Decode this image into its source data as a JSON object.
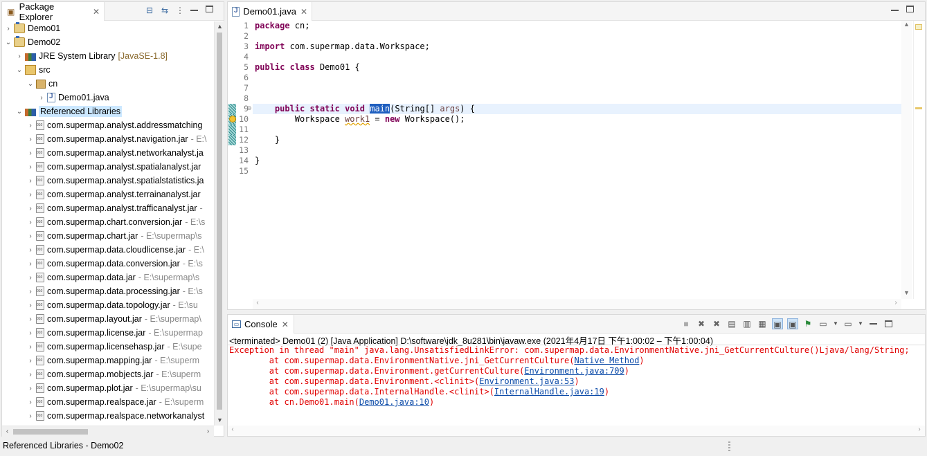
{
  "package_explorer": {
    "tab_label": "Package Explorer",
    "tree": [
      {
        "depth": 0,
        "chevron": "collapsed",
        "icon": "project",
        "label": "Demo01"
      },
      {
        "depth": 0,
        "chevron": "expanded",
        "icon": "project",
        "label": "Demo02"
      },
      {
        "depth": 1,
        "chevron": "collapsed",
        "icon": "library",
        "label": "JRE System Library",
        "tag": "[JavaSE-1.8]"
      },
      {
        "depth": 1,
        "chevron": "expanded",
        "icon": "src-folder",
        "label": "src"
      },
      {
        "depth": 2,
        "chevron": "expanded",
        "icon": "package",
        "label": "cn"
      },
      {
        "depth": 3,
        "chevron": "collapsed",
        "icon": "java-file",
        "label": "Demo01.java"
      },
      {
        "depth": 1,
        "chevron": "expanded",
        "icon": "library",
        "label": "Referenced Libraries",
        "selected": true
      },
      {
        "depth": 2,
        "chevron": "collapsed",
        "icon": "jar",
        "label": "com.supermap.analyst.addressmatching",
        "path": ""
      },
      {
        "depth": 2,
        "chevron": "collapsed",
        "icon": "jar",
        "label": "com.supermap.analyst.navigation.jar",
        "path": "- E:\\"
      },
      {
        "depth": 2,
        "chevron": "collapsed",
        "icon": "jar",
        "label": "com.supermap.analyst.networkanalyst.ja",
        "path": ""
      },
      {
        "depth": 2,
        "chevron": "collapsed",
        "icon": "jar",
        "label": "com.supermap.analyst.spatialanalyst.jar",
        "path": ""
      },
      {
        "depth": 2,
        "chevron": "collapsed",
        "icon": "jar",
        "label": "com.supermap.analyst.spatialstatistics.ja",
        "path": ""
      },
      {
        "depth": 2,
        "chevron": "collapsed",
        "icon": "jar",
        "label": "com.supermap.analyst.terrainanalyst.jar",
        "path": ""
      },
      {
        "depth": 2,
        "chevron": "collapsed",
        "icon": "jar",
        "label": "com.supermap.analyst.trafficanalyst.jar",
        "path": "-"
      },
      {
        "depth": 2,
        "chevron": "collapsed",
        "icon": "jar",
        "label": "com.supermap.chart.conversion.jar",
        "path": "- E:\\s"
      },
      {
        "depth": 2,
        "chevron": "collapsed",
        "icon": "jar",
        "label": "com.supermap.chart.jar",
        "path": "- E:\\supermap\\s"
      },
      {
        "depth": 2,
        "chevron": "collapsed",
        "icon": "jar",
        "label": "com.supermap.data.cloudlicense.jar",
        "path": "- E:\\"
      },
      {
        "depth": 2,
        "chevron": "collapsed",
        "icon": "jar",
        "label": "com.supermap.data.conversion.jar",
        "path": "- E:\\s"
      },
      {
        "depth": 2,
        "chevron": "collapsed",
        "icon": "jar",
        "label": "com.supermap.data.jar",
        "path": "- E:\\supermap\\s"
      },
      {
        "depth": 2,
        "chevron": "collapsed",
        "icon": "jar",
        "label": "com.supermap.data.processing.jar",
        "path": "- E:\\s"
      },
      {
        "depth": 2,
        "chevron": "collapsed",
        "icon": "jar",
        "label": "com.supermap.data.topology.jar",
        "path": "- E:\\su"
      },
      {
        "depth": 2,
        "chevron": "collapsed",
        "icon": "jar",
        "label": "com.supermap.layout.jar",
        "path": "- E:\\supermap\\"
      },
      {
        "depth": 2,
        "chevron": "collapsed",
        "icon": "jar",
        "label": "com.supermap.license.jar",
        "path": "- E:\\supermap"
      },
      {
        "depth": 2,
        "chevron": "collapsed",
        "icon": "jar",
        "label": "com.supermap.licensehasp.jar",
        "path": "- E:\\supe"
      },
      {
        "depth": 2,
        "chevron": "collapsed",
        "icon": "jar",
        "label": "com.supermap.mapping.jar",
        "path": "- E:\\superm"
      },
      {
        "depth": 2,
        "chevron": "collapsed",
        "icon": "jar",
        "label": "com.supermap.mobjects.jar",
        "path": "- E:\\superm"
      },
      {
        "depth": 2,
        "chevron": "collapsed",
        "icon": "jar",
        "label": "com.supermap.plot.jar",
        "path": "- E:\\supermap\\su"
      },
      {
        "depth": 2,
        "chevron": "collapsed",
        "icon": "jar",
        "label": "com.supermap.realspace.jar",
        "path": "- E:\\superm"
      },
      {
        "depth": 2,
        "chevron": "collapsed",
        "icon": "jar",
        "label": "com.supermap.realspace.networkanalyst",
        "path": ""
      }
    ]
  },
  "editor": {
    "tab_label": "Demo01.java",
    "line_numbers": [
      "1",
      "2",
      "3",
      "4",
      "5",
      "6",
      "7",
      "8",
      "9",
      "10",
      "11",
      "12",
      "13",
      "14",
      "15"
    ],
    "lines": {
      "l1_kw": "package",
      "l1_rest": " cn;",
      "l3_kw": "import",
      "l3_rest": " com.supermap.data.Workspace;",
      "l5_kw1": "public",
      "l5_kw2": "class",
      "l5_rest": " Demo01 {",
      "l9_kw1": "public",
      "l9_kw2": "static",
      "l9_kw3": "void",
      "l9_name": "main",
      "l9_a": "(String[] ",
      "l9_param": "args",
      "l9_b": ") {",
      "l10_a": "        Workspace ",
      "l10_var": "work1",
      "l10_b": " = ",
      "l10_kw": "new",
      "l10_c": " Workspace();",
      "l12": "    }",
      "l14": "}"
    }
  },
  "console": {
    "tab_label": "Console",
    "description": "<terminated> Demo01 (2) [Java Application] D:\\software\\jdk_8u281\\bin\\javaw.exe  (2021年4月17日 下午1:00:02 – 下午1:00:04)",
    "output": [
      {
        "text": "Exception in thread \"main\" java.lang.UnsatisfiedLinkError: com.supermap.data.EnvironmentNative.jni_GetCurrentCulture()Ljava/lang/String;",
        "link": "",
        "tail": ""
      },
      {
        "text": "\tat com.supermap.data.EnvironmentNative.jni_GetCurrentCulture(",
        "link": "Native Method",
        "tail": ")"
      },
      {
        "text": "\tat com.supermap.data.Environment.getCurrentCulture(",
        "link": "Environment.java:709",
        "tail": ")"
      },
      {
        "text": "\tat com.supermap.data.Environment.<clinit>(",
        "link": "Environment.java:53",
        "tail": ")"
      },
      {
        "text": "\tat com.supermap.data.InternalHandle.<clinit>(",
        "link": "InternalHandle.java:19",
        "tail": ")"
      },
      {
        "text": "\tat cn.Demo01.main(",
        "link": "Demo01.java:10",
        "tail": ")"
      }
    ]
  },
  "status_bar": {
    "text": "Referenced Libraries - Demo02"
  },
  "colors": {
    "keyword": "#7f0055",
    "error_text": "#e00000",
    "link": "#0b4aa8",
    "selection": "#cce8ff",
    "occurrence": "#1f5fbf"
  }
}
